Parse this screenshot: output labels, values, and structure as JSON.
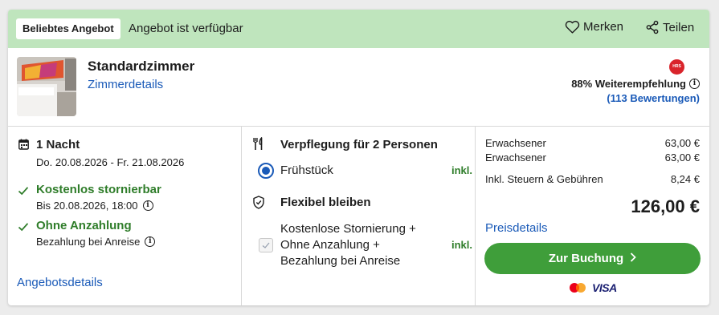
{
  "banner": {
    "badge": "Beliebtes Angebot",
    "availability": "Angebot ist verfügbar",
    "save_label": "Merken",
    "share_label": "Teilen"
  },
  "room": {
    "title": "Standardzimmer",
    "details_link": "Zimmerdetails",
    "provider_logo": "HRS",
    "recommendation": "88% Weiterempfehlung",
    "reviews": "(113 Bewertungen)"
  },
  "stay": {
    "nights": "1 Nacht",
    "dates": "Do. 20.08.2026 - Fr. 21.08.2026",
    "cancel_title": "Kostenlos stornierbar",
    "cancel_until": "Bis 20.08.2026, 18:00",
    "deposit_title": "Ohne Anzahlung",
    "deposit_sub": "Bezahlung bei Anreise",
    "offer_link": "Angebotsdetails"
  },
  "catering": {
    "title": "Verpflegung für 2 Personen",
    "option": "Frühstück",
    "option_inkl": "inkl.",
    "flex_title": "Flexibel bleiben",
    "flex_line1": "Kostenlose Stornierung +",
    "flex_line2": "Ohne Anzahlung +",
    "flex_line3": "Bezahlung bei Anreise",
    "flex_inkl": "inkl."
  },
  "pricing": {
    "rows": [
      {
        "label": "Erwachsener",
        "value": "63,00 €"
      },
      {
        "label": "Erwachsener",
        "value": "63,00 €"
      }
    ],
    "tax_label": "Inkl. Steuern & Gebühren",
    "tax_value": "8,24 €",
    "total": "126,00 €",
    "details_link": "Preisdetails",
    "book_label": "Zur Buchung",
    "payment_visa": "VISA"
  },
  "colors": {
    "banner": "#bfe5bd",
    "accent_link": "#1a5ab8",
    "green_text": "#2f7d2a",
    "book_button": "#3f9e3a"
  }
}
